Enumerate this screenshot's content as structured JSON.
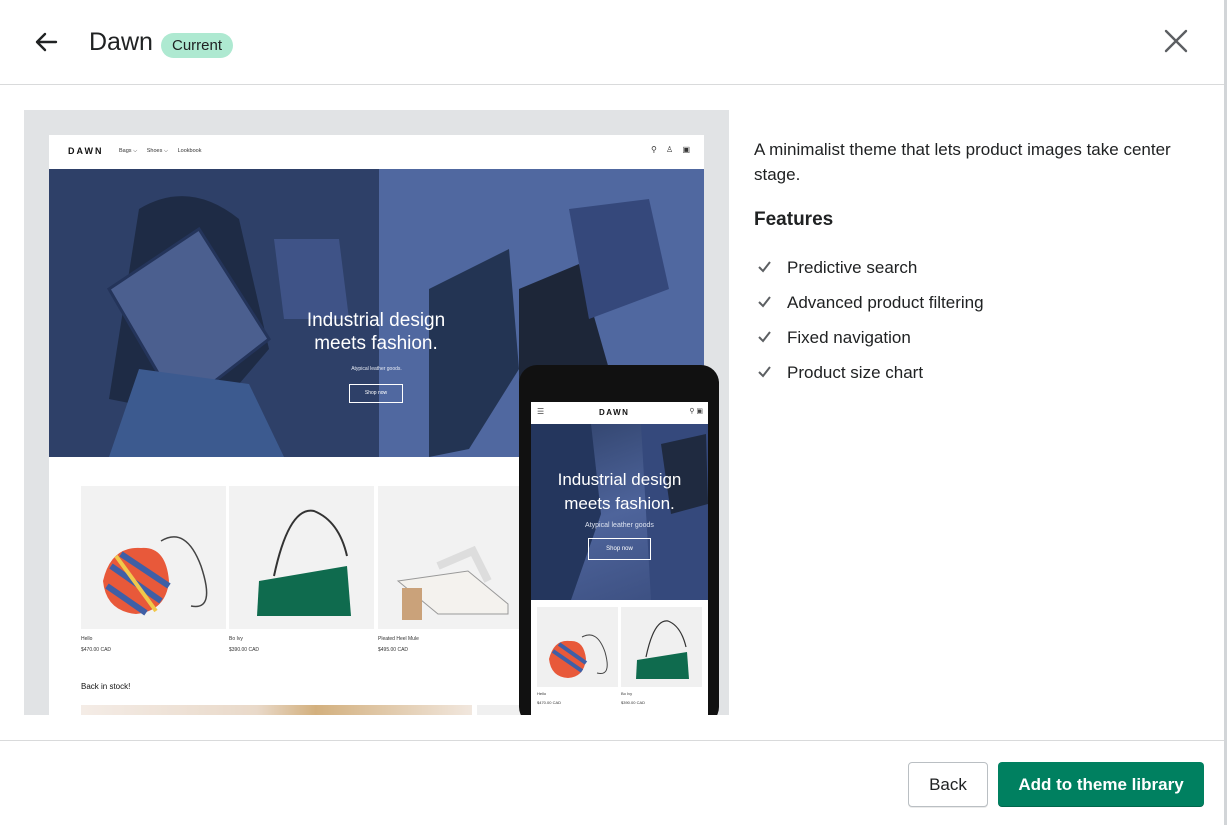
{
  "header": {
    "title": "Dawn",
    "badge": "Current"
  },
  "preview": {
    "desktop": {
      "logo": "DAWN",
      "nav": [
        "Bags ⌵",
        "Shoes ⌵",
        "Lookbook"
      ],
      "hero_title_line1": "Industrial design",
      "hero_title_line2": "meets fashion.",
      "hero_subtitle": "Atypical leather goods.",
      "hero_button": "Shop now",
      "products": [
        {
          "name": "Hello",
          "price": "$470.00 CAD"
        },
        {
          "name": "Bo Ivy",
          "price": "$390.00 CAD"
        },
        {
          "name": "Pleated Heel Mule",
          "price": "$495.00 CAD"
        }
      ],
      "section_title": "Back in stock!"
    },
    "mobile": {
      "logo": "DAWN",
      "hero_title_line1": "Industrial design",
      "hero_title_line2": "meets fashion.",
      "hero_subtitle": "Atypical leather goods",
      "hero_button": "Shop now",
      "products": [
        {
          "name": "Hello",
          "price": "$470.00 CAD"
        },
        {
          "name": "Bo Ivy",
          "price": "$390.00 CAD"
        }
      ]
    }
  },
  "details": {
    "description": "A minimalist theme that lets product images take center stage.",
    "features_title": "Features",
    "features": [
      "Predictive search",
      "Advanced product filtering",
      "Fixed navigation",
      "Product size chart"
    ]
  },
  "footer": {
    "back_label": "Back",
    "add_label": "Add to theme library"
  },
  "colors": {
    "primary": "#008060",
    "badge_bg": "#aee9d1",
    "text": "#202223"
  },
  "icons": {
    "back": "arrow-left-icon",
    "close": "close-icon",
    "feature": "checkmark-icon"
  }
}
